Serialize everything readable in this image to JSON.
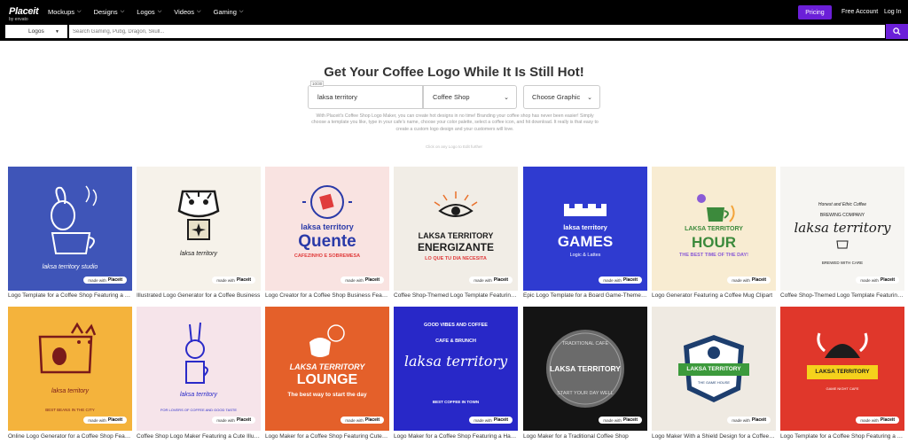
{
  "nav": {
    "logo_main": "Placeit",
    "logo_sub": "by envato",
    "menu": [
      "Mockups",
      "Designs",
      "Logos",
      "Videos",
      "Gaming"
    ],
    "pricing": "Pricing",
    "free_account": "Free Account",
    "login": "Log In"
  },
  "search": {
    "category": "Logos",
    "placeholder": "Search Gaming, Pubg, Dragon, Skull..."
  },
  "hero": {
    "title": "Get Your Coffee Logo While It Is Still Hot!",
    "text_field_tag": "10/30",
    "text_field_value": "laksa territory",
    "industry_value": "Coffee Shop",
    "graphic_value": "Choose Graphic",
    "description": "With Placeit's Coffee Shop Logo Maker, you can create hot designs in no time! Branding your coffee shop has never been easier! Simply choose a template you like, type in your cafe's name, choose your color palette, select a coffee icon, and hit download. It really is that easy to create a custom logo design and your customers will love.",
    "hint": "Click on any Logo to Edit further"
  },
  "tiles_row1": [
    {
      "caption": "Logo Template for a Coffee Shop Featuring a Dog",
      "bg": "#3f55b8",
      "name": "laksa territory studio"
    },
    {
      "caption": "Illustrated Logo Generator for a Coffee Business",
      "bg": "#f6f2ea",
      "name": "laksa territory"
    },
    {
      "caption": "Logo Creator for a Coffee Shop Business Featuring",
      "bg": "#f9e3e1",
      "name": "laksa territory",
      "big": "Quente",
      "tagline": "CAFEZINHO E SOBREMESA"
    },
    {
      "caption": "Coffee Shop-Themed Logo Template Featuring an Eye",
      "bg": "#f1ede6",
      "name": "LAKSA TERRITORY",
      "big": "ENERGIZANTE",
      "tagline": "LO QUE TU DIA NECESITA"
    },
    {
      "caption": "Epic Logo Template for a Board Game-Themed Cafe",
      "bg": "#2f3bd0",
      "name": "laksa territory",
      "big": "GAMES",
      "tagline": "Logic & Lattes"
    },
    {
      "caption": "Logo Generator Featuring a Coffee Mug Clipart",
      "bg": "#f8ecd2",
      "name": "LAKSA TERRITORY",
      "big": "HOUR",
      "tagline": "THE BEST TIME OF THE DAY!"
    },
    {
      "caption": "Coffee Shop-Themed Logo Template Featuring Text",
      "bg": "#f6f5f2",
      "name": "laksa territory",
      "top": "Honest and Ethic Coffee",
      "sub": "BREWING COMPANY",
      "tagline": "BREWED WITH CARE"
    }
  ],
  "tiles_row2": [
    {
      "caption": "Online Logo Generator for a Coffee Shop Featuring",
      "bg": "#f4b33c",
      "name": "laksa territory",
      "tagline": "BEST BEANS IN THE CITY"
    },
    {
      "caption": "Coffee Shop Logo Maker Featuring a Cute Illustration",
      "bg": "#f6e4ea",
      "name": "laksa territory",
      "tagline": "FOR LOVERS OF COFFEE AND GOOD TASTE"
    },
    {
      "caption": "Logo Maker for a Coffee Shop Featuring Cute Graphics",
      "bg": "#e4602a",
      "name": "LAKSA TERRITORY",
      "big": "LOUNGE",
      "tagline": "The best way to start the day"
    },
    {
      "caption": "Logo Maker for a Coffee Shop Featuring a Handwritten",
      "bg": "#2828c8",
      "name": "laksa territory",
      "top": "GOOD VIBES AND COFFEE",
      "sub": "CAFE & BRUNCH",
      "tagline": "BEST COFFEE IN TOWN"
    },
    {
      "caption": "Logo Maker for a Traditional Coffee Shop",
      "bg": "#141414",
      "name": "LAKSA TERRITORY",
      "top": "TRADITIONAL CAFE",
      "tagline": "START YOUR DAY WELL"
    },
    {
      "caption": "Logo Maker With a Shield Design for a Coffee Shop",
      "bg": "#efeae2",
      "name": "LAKSA TERRITORY",
      "tagline": "THE GAME HOUSE"
    },
    {
      "caption": "Logo Template for a Coffee Shop Featuring a Game Night",
      "bg": "#e0372b",
      "name": "LAKSA TERRITORY",
      "tagline": "GAME NIGHT CAFE"
    }
  ],
  "badge": {
    "made_with": "made with",
    "brand": "Placeit"
  },
  "colors": {
    "accent": "#6b1fd8",
    "nav_bg": "#000000"
  }
}
